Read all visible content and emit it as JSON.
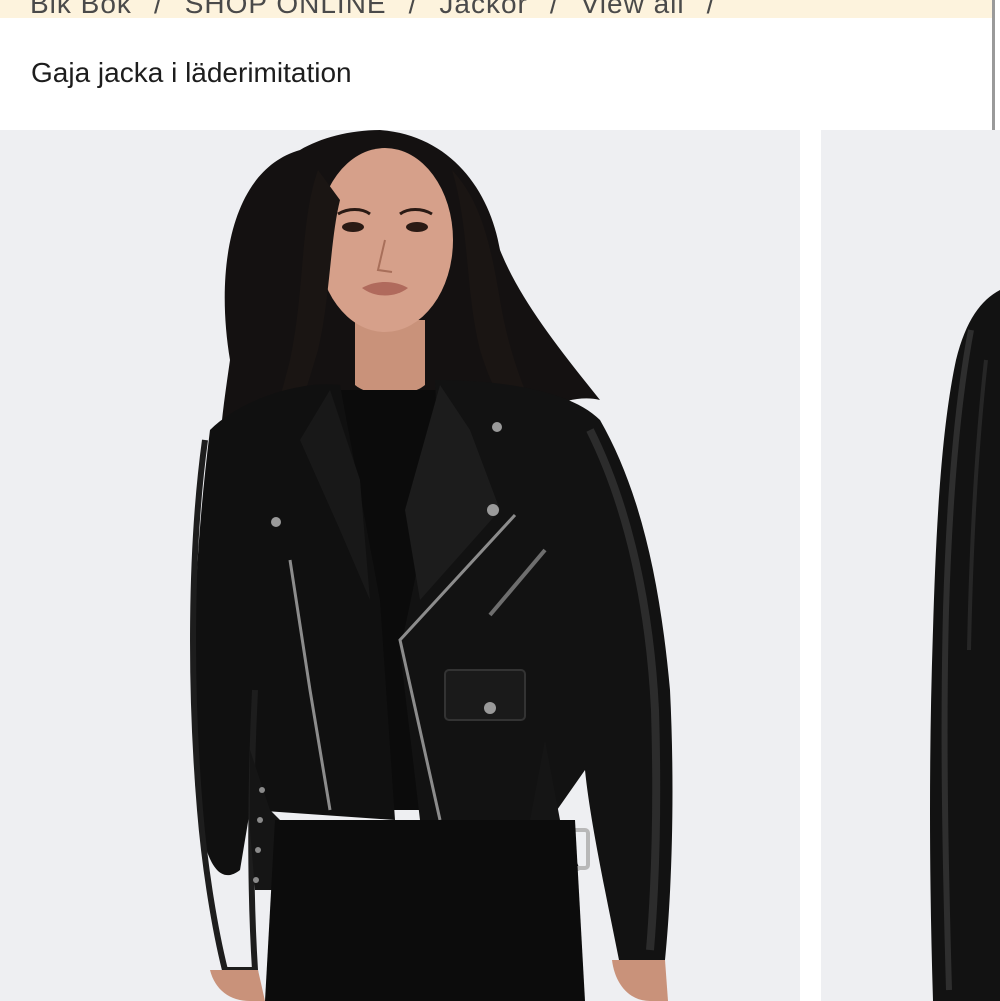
{
  "breadcrumb": {
    "items": [
      "Bik Bok",
      "SHOP ONLINE",
      "Jackor",
      "View all"
    ],
    "separator": "/"
  },
  "product": {
    "title": "Gaja jacka i läderimitation"
  },
  "colors": {
    "banner": "#fdf3dd",
    "photo_background": "#eeeff2",
    "text": "#1d1d1d"
  }
}
